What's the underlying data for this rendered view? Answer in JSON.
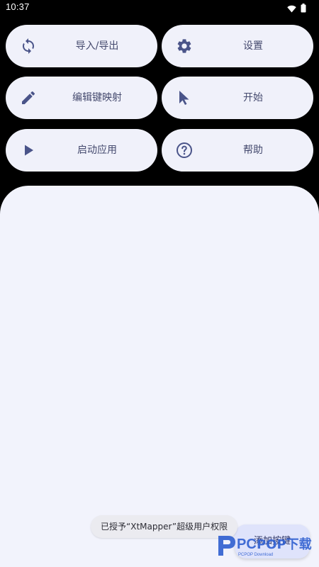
{
  "status_bar": {
    "time": "10:37",
    "icons": [
      "wifi-icon",
      "battery-icon"
    ]
  },
  "buttons": [
    {
      "id": "import-export",
      "label": "导入/导出",
      "icon": "sync-icon"
    },
    {
      "id": "settings",
      "label": "设置",
      "icon": "gear-icon"
    },
    {
      "id": "edit-keymap",
      "label": "编辑键映射",
      "icon": "pencil-icon"
    },
    {
      "id": "start",
      "label": "开始",
      "icon": "cursor-arrow-icon"
    },
    {
      "id": "launch-app",
      "label": "启动应用",
      "icon": "play-icon"
    },
    {
      "id": "help",
      "label": "帮助",
      "icon": "help-circle-icon"
    }
  ],
  "toast": {
    "message": "已授予“XtMapper”超级用户权限"
  },
  "fab": {
    "label": "添加按键"
  },
  "watermark": {
    "brand": "PC",
    "sub": "PCPOP Download",
    "text": "POP下载"
  },
  "colors": {
    "background": "#000000",
    "button_bg": "#f0f1fa",
    "icon": "#4a5489",
    "label": "#454a6e",
    "panel": "#f2f3fc",
    "fab": "#dfe3fb",
    "watermark": "#2f5fd0"
  }
}
